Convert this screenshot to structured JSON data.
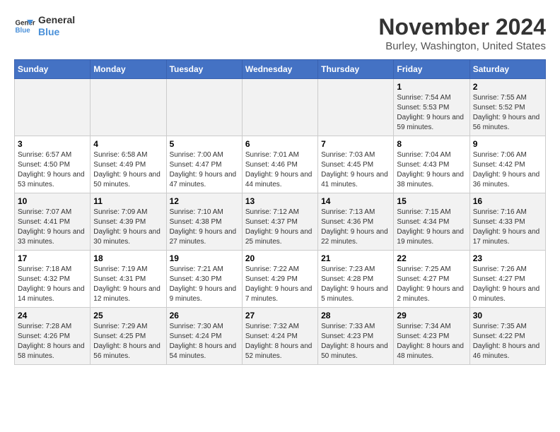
{
  "logo": {
    "line1": "General",
    "line2": "Blue"
  },
  "title": "November 2024",
  "location": "Burley, Washington, United States",
  "weekdays": [
    "Sunday",
    "Monday",
    "Tuesday",
    "Wednesday",
    "Thursday",
    "Friday",
    "Saturday"
  ],
  "weeks": [
    [
      {
        "day": "",
        "info": ""
      },
      {
        "day": "",
        "info": ""
      },
      {
        "day": "",
        "info": ""
      },
      {
        "day": "",
        "info": ""
      },
      {
        "day": "",
        "info": ""
      },
      {
        "day": "1",
        "info": "Sunrise: 7:54 AM\nSunset: 5:53 PM\nDaylight: 9 hours and 59 minutes."
      },
      {
        "day": "2",
        "info": "Sunrise: 7:55 AM\nSunset: 5:52 PM\nDaylight: 9 hours and 56 minutes."
      }
    ],
    [
      {
        "day": "3",
        "info": "Sunrise: 6:57 AM\nSunset: 4:50 PM\nDaylight: 9 hours and 53 minutes."
      },
      {
        "day": "4",
        "info": "Sunrise: 6:58 AM\nSunset: 4:49 PM\nDaylight: 9 hours and 50 minutes."
      },
      {
        "day": "5",
        "info": "Sunrise: 7:00 AM\nSunset: 4:47 PM\nDaylight: 9 hours and 47 minutes."
      },
      {
        "day": "6",
        "info": "Sunrise: 7:01 AM\nSunset: 4:46 PM\nDaylight: 9 hours and 44 minutes."
      },
      {
        "day": "7",
        "info": "Sunrise: 7:03 AM\nSunset: 4:45 PM\nDaylight: 9 hours and 41 minutes."
      },
      {
        "day": "8",
        "info": "Sunrise: 7:04 AM\nSunset: 4:43 PM\nDaylight: 9 hours and 38 minutes."
      },
      {
        "day": "9",
        "info": "Sunrise: 7:06 AM\nSunset: 4:42 PM\nDaylight: 9 hours and 36 minutes."
      }
    ],
    [
      {
        "day": "10",
        "info": "Sunrise: 7:07 AM\nSunset: 4:41 PM\nDaylight: 9 hours and 33 minutes."
      },
      {
        "day": "11",
        "info": "Sunrise: 7:09 AM\nSunset: 4:39 PM\nDaylight: 9 hours and 30 minutes."
      },
      {
        "day": "12",
        "info": "Sunrise: 7:10 AM\nSunset: 4:38 PM\nDaylight: 9 hours and 27 minutes."
      },
      {
        "day": "13",
        "info": "Sunrise: 7:12 AM\nSunset: 4:37 PM\nDaylight: 9 hours and 25 minutes."
      },
      {
        "day": "14",
        "info": "Sunrise: 7:13 AM\nSunset: 4:36 PM\nDaylight: 9 hours and 22 minutes."
      },
      {
        "day": "15",
        "info": "Sunrise: 7:15 AM\nSunset: 4:34 PM\nDaylight: 9 hours and 19 minutes."
      },
      {
        "day": "16",
        "info": "Sunrise: 7:16 AM\nSunset: 4:33 PM\nDaylight: 9 hours and 17 minutes."
      }
    ],
    [
      {
        "day": "17",
        "info": "Sunrise: 7:18 AM\nSunset: 4:32 PM\nDaylight: 9 hours and 14 minutes."
      },
      {
        "day": "18",
        "info": "Sunrise: 7:19 AM\nSunset: 4:31 PM\nDaylight: 9 hours and 12 minutes."
      },
      {
        "day": "19",
        "info": "Sunrise: 7:21 AM\nSunset: 4:30 PM\nDaylight: 9 hours and 9 minutes."
      },
      {
        "day": "20",
        "info": "Sunrise: 7:22 AM\nSunset: 4:29 PM\nDaylight: 9 hours and 7 minutes."
      },
      {
        "day": "21",
        "info": "Sunrise: 7:23 AM\nSunset: 4:28 PM\nDaylight: 9 hours and 5 minutes."
      },
      {
        "day": "22",
        "info": "Sunrise: 7:25 AM\nSunset: 4:27 PM\nDaylight: 9 hours and 2 minutes."
      },
      {
        "day": "23",
        "info": "Sunrise: 7:26 AM\nSunset: 4:27 PM\nDaylight: 9 hours and 0 minutes."
      }
    ],
    [
      {
        "day": "24",
        "info": "Sunrise: 7:28 AM\nSunset: 4:26 PM\nDaylight: 8 hours and 58 minutes."
      },
      {
        "day": "25",
        "info": "Sunrise: 7:29 AM\nSunset: 4:25 PM\nDaylight: 8 hours and 56 minutes."
      },
      {
        "day": "26",
        "info": "Sunrise: 7:30 AM\nSunset: 4:24 PM\nDaylight: 8 hours and 54 minutes."
      },
      {
        "day": "27",
        "info": "Sunrise: 7:32 AM\nSunset: 4:24 PM\nDaylight: 8 hours and 52 minutes."
      },
      {
        "day": "28",
        "info": "Sunrise: 7:33 AM\nSunset: 4:23 PM\nDaylight: 8 hours and 50 minutes."
      },
      {
        "day": "29",
        "info": "Sunrise: 7:34 AM\nSunset: 4:23 PM\nDaylight: 8 hours and 48 minutes."
      },
      {
        "day": "30",
        "info": "Sunrise: 7:35 AM\nSunset: 4:22 PM\nDaylight: 8 hours and 46 minutes."
      }
    ]
  ]
}
